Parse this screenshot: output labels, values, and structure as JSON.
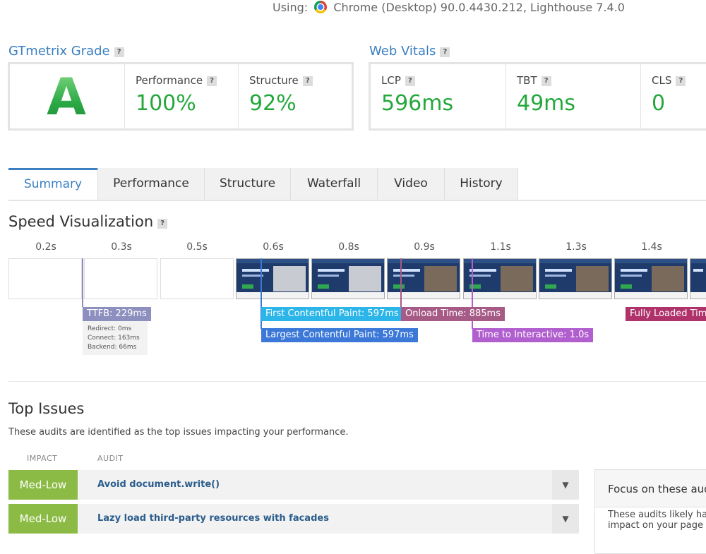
{
  "header": {
    "using_label": "Using:",
    "using_value": "Chrome (Desktop) 90.0.4430.212, Lighthouse 7.4.0"
  },
  "grade": {
    "title": "GTmetrix Grade",
    "help": "?",
    "letter": "A",
    "metrics": [
      {
        "label": "Performance",
        "value": "100%"
      },
      {
        "label": "Structure",
        "value": "92%"
      }
    ]
  },
  "vitals": {
    "title": "Web Vitals",
    "help": "?",
    "metrics": [
      {
        "label": "LCP",
        "value": "596ms"
      },
      {
        "label": "TBT",
        "value": "49ms"
      },
      {
        "label": "CLS",
        "value": "0"
      }
    ]
  },
  "tabs": [
    "Summary",
    "Performance",
    "Structure",
    "Waterfall",
    "Video",
    "History"
  ],
  "active_tab": "Summary",
  "speed": {
    "title": "Speed Visualization",
    "help": "?",
    "times": [
      "0.2s",
      "0.3s",
      "0.5s",
      "0.6s",
      "0.8s",
      "0.9s",
      "1.1s",
      "1.3s",
      "1.4s"
    ],
    "markers": {
      "ttfb": "TTFB: 229ms",
      "ttfb_details": [
        "Redirect: 0ms",
        "Connect: 163ms",
        "Backend: 66ms"
      ],
      "fcp": "First Contentful Paint: 597ms",
      "lcp": "Largest Contentful Paint: 597ms",
      "onload": "Onload Time: 885ms",
      "tti": "Time to Interactive: 1.0s",
      "fully_loaded": "Fully Loaded Time:"
    },
    "colors": {
      "ttfb": "#8d8fbf",
      "fcp": "#2bb5e8",
      "lcp": "#3b78d8",
      "onload": "#a65a86",
      "tti": "#b15fcf",
      "fully_loaded": "#b0326b"
    }
  },
  "issues": {
    "title": "Top Issues",
    "description": "These audits are identified as the top issues impacting your performance.",
    "col_impact": "IMPACT",
    "col_audit": "AUDIT",
    "rows": [
      {
        "impact": "Med-Low",
        "audit": "Avoid document.write()"
      },
      {
        "impact": "Med-Low",
        "audit": "Lazy load third-party resources with facades"
      }
    ],
    "focus": {
      "title": "Focus on these aud",
      "body": "These audits likely hav impact on your page p"
    }
  }
}
